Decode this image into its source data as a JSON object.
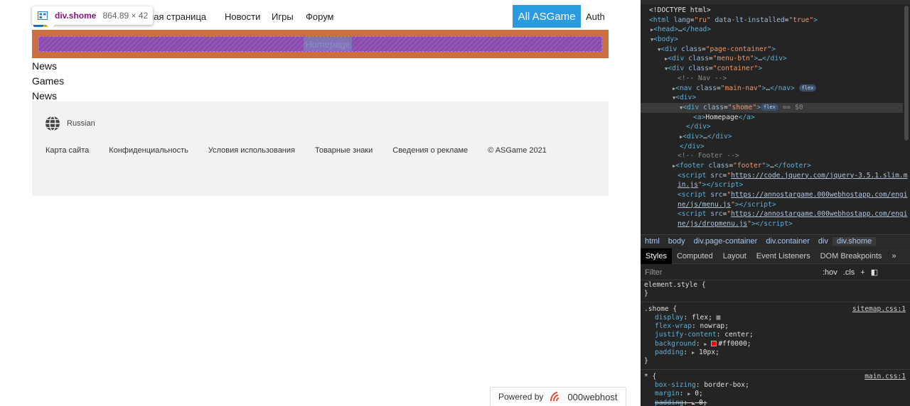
{
  "nav": {
    "links": [
      "Главная страница",
      "Новости",
      "Игры",
      "Форум"
    ],
    "cta_label": "All ASGame",
    "auth_label": "Auth"
  },
  "tooltip": {
    "name": "div.shome",
    "size": "864.89 × 42"
  },
  "shome": {
    "link_label": "Homepage",
    "bg_color": "#ff0000"
  },
  "plain_list": [
    "News",
    "Games",
    "News"
  ],
  "footer": {
    "language": "Russian",
    "links": [
      "Карта сайта",
      "Конфиденциальность",
      "Условия использования",
      "Товарные знаки",
      "Сведения о рекламе",
      "© ASGame 2021"
    ]
  },
  "powered": {
    "prefix": "Powered by",
    "brand": "000webhost"
  },
  "devtools": {
    "dom_lines": [
      {
        "indent": 12,
        "html": "<span class='tx'>&lt;!DOCTYPE html&gt;</span>"
      },
      {
        "indent": 12,
        "html": "<span class='tg'>&lt;html</span> <span class='an'>lang</span>=<span class='av'>\"ru\"</span> <span class='an'>data-lt-installed</span>=<span class='av'>\"true\"</span><span class='tg'>&gt;</span>"
      },
      {
        "indent": 14,
        "html": "<span class='arrow'>▶</span><span class='tg'>&lt;head&gt;</span>…<span class='tg'>&lt;/head&gt;</span>"
      },
      {
        "indent": 14,
        "html": "<span class='arrow'>▼</span><span class='tg'>&lt;body&gt;</span>"
      },
      {
        "indent": 24,
        "html": "<span class='arrow'>▼</span><span class='tg'>&lt;div</span> <span class='an'>class</span>=<span class='av'>\"page-container\"</span><span class='tg'>&gt;</span>"
      },
      {
        "indent": 34,
        "html": "<span class='arrow'>▶</span><span class='tg'>&lt;div</span> <span class='an'>class</span>=<span class='av'>\"menu-btn\"</span><span class='tg'>&gt;</span>…<span class='tg'>&lt;/div&gt;</span>"
      },
      {
        "indent": 34,
        "html": "<span class='arrow'>▼</span><span class='tg'>&lt;div</span> <span class='an'>class</span>=<span class='av'>\"container\"</span><span class='tg'>&gt;</span>"
      },
      {
        "indent": 52,
        "html": "<span class='cm'>&lt;!-- Nav --&gt;</span>"
      },
      {
        "indent": 45,
        "html": "<span class='arrow'>▶</span><span class='tg'>&lt;nav</span> <span class='an'>class</span>=<span class='av'>\"main-nav\"</span><span class='tg'>&gt;</span>…<span class='tg'>&lt;/nav&gt;</span> <span class='badge'>flex</span>"
      },
      {
        "indent": 45,
        "html": "<span class='arrow'>▼</span><span class='tg'>&lt;div&gt;</span>"
      },
      {
        "indent": 55,
        "html": "<span class='arrow'>▼</span><span class='tg'>&lt;div</span> <span class='an'>class</span>=<span class='av'>\"shome\"</span><span class='tg'>&gt;</span><span class='badge'>flex</span> <span class='cm'>== $0</span>",
        "selected": true
      },
      {
        "indent": 74,
        "html": "<span class='tg'>&lt;a&gt;</span><span class='tx'>Homepage</span><span class='tg'>&lt;/a&gt;</span>"
      },
      {
        "indent": 64,
        "html": "<span class='tg'>&lt;/div&gt;</span>"
      },
      {
        "indent": 55,
        "html": "<span class='arrow'>▶</span><span class='tg'>&lt;div&gt;</span>…<span class='tg'>&lt;/div&gt;</span>"
      },
      {
        "indent": 55,
        "html": "<span class='tg'>&lt;/div&gt;</span>"
      },
      {
        "indent": 52,
        "html": "<span class='cm'>&lt;!-- Footer --&gt;</span>"
      },
      {
        "indent": 45,
        "html": "<span class='arrow'>▶</span><span class='tg'>&lt;footer</span> <span class='an'>class</span>=<span class='av'>\"footer\"</span><span class='tg'>&gt;</span>…<span class='tg'>&lt;/footer&gt;</span>"
      },
      {
        "indent": 52,
        "html": "<span class='tg'>&lt;script</span> <span class='an'>src</span>=<span class='av'>\"</span><span class='lnk'>https://code.jquery.com/jquery-3.5.1.slim.m</span>"
      },
      {
        "indent": 52,
        "html": "<span class='lnk'>in.js</span><span class='av'>\"</span><span class='tg'>&gt;&lt;/script&gt;</span>"
      },
      {
        "indent": 52,
        "html": "<span class='tg'>&lt;script</span> <span class='an'>src</span>=<span class='av'>\"</span><span class='lnk'>https://annostargame.000webhostapp.com/engi</span>"
      },
      {
        "indent": 52,
        "html": "<span class='lnk'>ne/js/menu.js</span><span class='av'>\"</span><span class='tg'>&gt;&lt;/script&gt;</span>"
      },
      {
        "indent": 52,
        "html": "<span class='tg'>&lt;script</span> <span class='an'>src</span>=<span class='av'>\"</span><span class='lnk'>https://annostargame.000webhostapp.com/engi</span>"
      },
      {
        "indent": 52,
        "html": "<span class='lnk'>ne/js/dropmenu.js</span><span class='av'>\"</span><span class='tg'>&gt;&lt;/script&gt;</span>"
      }
    ],
    "breadcrumbs": [
      "html",
      "body",
      "div.page-container",
      "div.container",
      "div",
      "div.shome"
    ],
    "tabs": [
      "Styles",
      "Computed",
      "Layout",
      "Event Listeners",
      "DOM Breakpoints",
      "»"
    ],
    "filter_placeholder": "Filter",
    "filter_buttons": [
      ":hov",
      ".cls",
      "+"
    ],
    "styles": {
      "element_style": "element.style {",
      "rule1_selector": ".shome {",
      "rule1_source": "sitemap.css:1",
      "rule1_props": [
        {
          "prop": "display",
          "val": "flex;"
        },
        {
          "prop": "flex-wrap",
          "val": "nowrap;"
        },
        {
          "prop": "justify-content",
          "val": "center;"
        },
        {
          "prop": "background",
          "val": "#ff0000;"
        },
        {
          "prop": "padding",
          "val": "10px;"
        }
      ],
      "rule2_selector": "* {",
      "rule2_source": "main.css:1",
      "rule2_props": [
        {
          "prop": "box-sizing",
          "val": "border-box;"
        },
        {
          "prop": "margin",
          "val": "0;"
        },
        {
          "prop": "padding",
          "val": "0;"
        }
      ],
      "close_brace": "}"
    }
  }
}
